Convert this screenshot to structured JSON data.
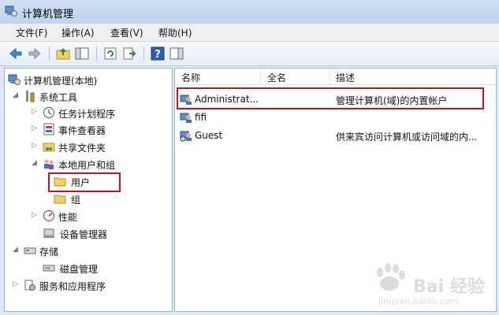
{
  "window": {
    "title": "计算机管理"
  },
  "menu": [
    "文件(F)",
    "操作(A)",
    "查看(V)",
    "帮助(H)"
  ],
  "toolbar": {
    "icons": [
      "back-arrow-icon",
      "forward-arrow-icon",
      "up-folder-icon",
      "show-hide-tree-icon",
      "refresh-icon",
      "export-list-icon",
      "help-icon",
      "properties-icon"
    ]
  },
  "tree": {
    "root": "计算机管理(本地)",
    "system_tools": "系统工具",
    "task_scheduler": "任务计划程序",
    "event_viewer": "事件查看器",
    "shared_folders": "共享文件夹",
    "local_users_groups": "本地用户和组",
    "users": "用户",
    "groups": "组",
    "performance": "性能",
    "device_manager": "设备管理器",
    "storage": "存储",
    "disk_management": "磁盘管理",
    "services_apps": "服务和应用程序"
  },
  "list": {
    "columns": [
      "名称",
      "全名",
      "描述"
    ],
    "rows": [
      {
        "name": "Administrat...",
        "full_name": "",
        "description": "管理计算机(域)的内置帐户"
      },
      {
        "name": "fifi",
        "full_name": "",
        "description": ""
      },
      {
        "name": "Guest",
        "full_name": "",
        "description": "供来宾访问计算机或访问域的内..."
      }
    ]
  },
  "watermark": {
    "brand": "Bai 经验",
    "url": "jingyan.baidu.com"
  },
  "colors": {
    "highlight_box": "#c8101e",
    "title_bar": "#bcd3ee",
    "pane_border": "#9fb1c6"
  }
}
